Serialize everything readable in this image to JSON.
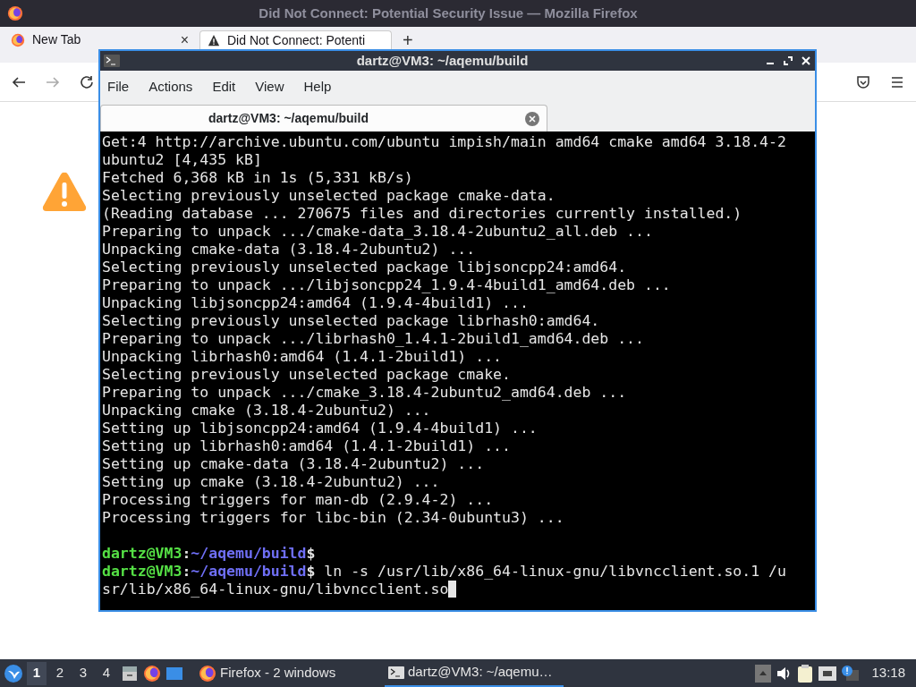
{
  "browser": {
    "title": "Did Not Connect: Potential Security Issue — Mozilla Firefox",
    "tabs": [
      {
        "label": "New Tab",
        "selected": false,
        "close": "×"
      },
      {
        "label": "Did Not Connect: Potenti",
        "selected": true
      }
    ],
    "new_tab": "+"
  },
  "terminal": {
    "title": "dartz@VM3: ~/aqemu/build",
    "menu": [
      "File",
      "Actions",
      "Edit",
      "View",
      "Help"
    ],
    "tabs": [
      {
        "label": "dartz@VM3: ~/aqemu/build",
        "selected": true
      }
    ],
    "lines": [
      {
        "kind": "output",
        "text": "Get:4 http://archive.ubuntu.com/ubuntu impish/main amd64 cmake amd64 3.18.4-2"
      },
      {
        "kind": "output",
        "text": "ubuntu2 [4,435 kB]"
      },
      {
        "kind": "output",
        "text": "Fetched 6,368 kB in 1s (5,331 kB/s)"
      },
      {
        "kind": "output",
        "text": "Selecting previously unselected package cmake-data."
      },
      {
        "kind": "output",
        "text": "(Reading database ... 270675 files and directories currently installed.)"
      },
      {
        "kind": "output",
        "text": "Preparing to unpack .../cmake-data_3.18.4-2ubuntu2_all.deb ..."
      },
      {
        "kind": "output",
        "text": "Unpacking cmake-data (3.18.4-2ubuntu2) ..."
      },
      {
        "kind": "output",
        "text": "Selecting previously unselected package libjsoncpp24:amd64."
      },
      {
        "kind": "output",
        "text": "Preparing to unpack .../libjsoncpp24_1.9.4-4build1_amd64.deb ..."
      },
      {
        "kind": "output",
        "text": "Unpacking libjsoncpp24:amd64 (1.9.4-4build1) ..."
      },
      {
        "kind": "output",
        "text": "Selecting previously unselected package librhash0:amd64."
      },
      {
        "kind": "output",
        "text": "Preparing to unpack .../librhash0_1.4.1-2build1_amd64.deb ..."
      },
      {
        "kind": "output",
        "text": "Unpacking librhash0:amd64 (1.4.1-2build1) ..."
      },
      {
        "kind": "output",
        "text": "Selecting previously unselected package cmake."
      },
      {
        "kind": "output",
        "text": "Preparing to unpack .../cmake_3.18.4-2ubuntu2_amd64.deb ..."
      },
      {
        "kind": "output",
        "text": "Unpacking cmake (3.18.4-2ubuntu2) ..."
      },
      {
        "kind": "output",
        "text": "Setting up libjsoncpp24:amd64 (1.9.4-4build1) ..."
      },
      {
        "kind": "output",
        "text": "Setting up librhash0:amd64 (1.4.1-2build1) ..."
      },
      {
        "kind": "output",
        "text": "Setting up cmake-data (3.18.4-2ubuntu2) ..."
      },
      {
        "kind": "output",
        "text": "Setting up cmake (3.18.4-2ubuntu2) ..."
      },
      {
        "kind": "output",
        "text": "Processing triggers for man-db (2.9.4-2) ..."
      },
      {
        "kind": "output",
        "text": "Processing triggers for libc-bin (2.34-0ubuntu3) ..."
      },
      {
        "kind": "blank"
      },
      {
        "kind": "prompt",
        "user": "dartz@VM3",
        "sep": ":",
        "path": "~/aqemu/build",
        "sign": "$"
      },
      {
        "kind": "prompt",
        "user": "dartz@VM3",
        "sep": ":",
        "path": "~/aqemu/build",
        "sign": "$",
        "command": " ln -s /usr/lib/x86_64-linux-gnu/libvncclient.so.1 /u"
      },
      {
        "kind": "output",
        "text": "sr/lib/x86_64-linux-gnu/libvncclient.so",
        "cursor": true
      }
    ]
  },
  "taskbar": {
    "workspaces": [
      {
        "label": "1",
        "selected": true
      },
      {
        "label": "2",
        "selected": false
      },
      {
        "label": "3",
        "selected": false
      },
      {
        "label": "4",
        "selected": false
      }
    ],
    "tasks": [
      {
        "label": "Firefox - 2 windows",
        "kind": "firefox",
        "selected": false
      },
      {
        "label": "dartz@VM3: ~/aqemu…",
        "kind": "terminal",
        "selected": true
      }
    ],
    "clock": "13:18"
  }
}
